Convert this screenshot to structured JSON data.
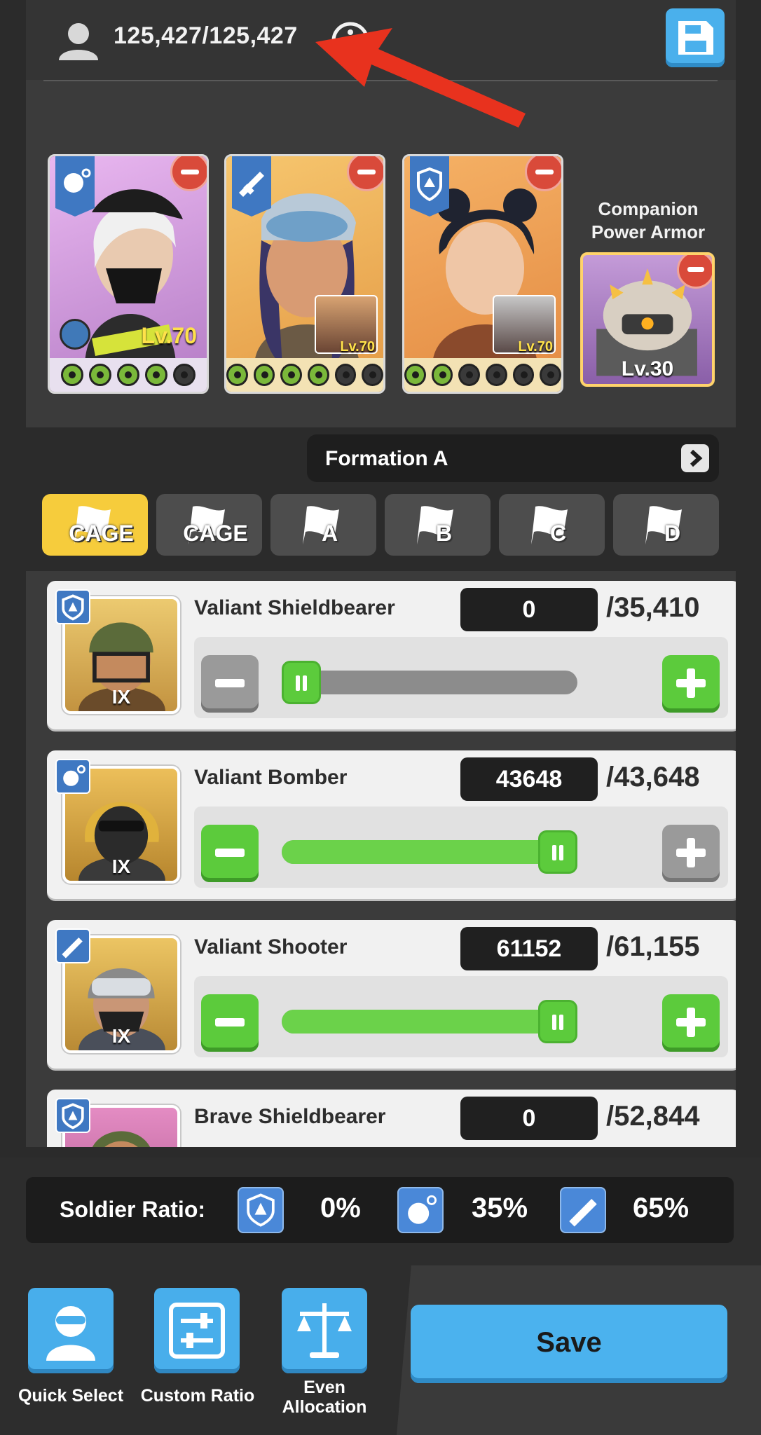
{
  "header": {
    "troop_count": "125,427/125,427"
  },
  "heroes": [
    {
      "level": "Lv.70",
      "card_color": "#d9a9de",
      "badge": "grenade-icon",
      "has_flag": true
    },
    {
      "level": "",
      "card_color": "#f1b261",
      "badge": "rifle-icon",
      "linked_level": "Lv.70"
    },
    {
      "level": "",
      "card_color": "#f0a45a",
      "badge": "shield-icon",
      "linked_level": "Lv.70"
    }
  ],
  "companion": {
    "label": "Companion Power Armor",
    "level": "Lv.30"
  },
  "formation": {
    "label": "Formation A"
  },
  "tabs": [
    {
      "label": "CAGE",
      "active": true
    },
    {
      "label": "CAGE",
      "active": false
    },
    {
      "label": "A",
      "active": false
    },
    {
      "label": "B",
      "active": false
    },
    {
      "label": "C",
      "active": false
    },
    {
      "label": "D",
      "active": false
    }
  ],
  "units": [
    {
      "name": "Valiant Shieldbearer",
      "count": "0",
      "max": "/35,410",
      "tier": "IX",
      "type": "shield-icon",
      "fill": 0.0,
      "bg": "#e9c46a"
    },
    {
      "name": "Valiant Bomber",
      "count": "43648",
      "max": "/43,648",
      "tier": "IX",
      "type": "grenade-icon",
      "fill": 1.0,
      "bg": "#e9b54a"
    },
    {
      "name": "Valiant Shooter",
      "count": "61152",
      "max": "/61,155",
      "tier": "IX",
      "type": "rifle-icon",
      "fill": 1.0,
      "bg": "#e7b552"
    },
    {
      "name": "Brave Shieldbearer",
      "count": "0",
      "max": "/52,844",
      "tier": "",
      "type": "shield-icon",
      "fill": 0.0,
      "bg": "#d97fb8"
    }
  ],
  "ratio": {
    "label": "Soldier Ratio:",
    "shield": "0%",
    "grenade": "35%",
    "rifle": "65%"
  },
  "actions": {
    "quick_select": "Quick Select",
    "custom_ratio": "Custom Ratio",
    "even_allocation": "Even Allocation",
    "save": "Save"
  }
}
